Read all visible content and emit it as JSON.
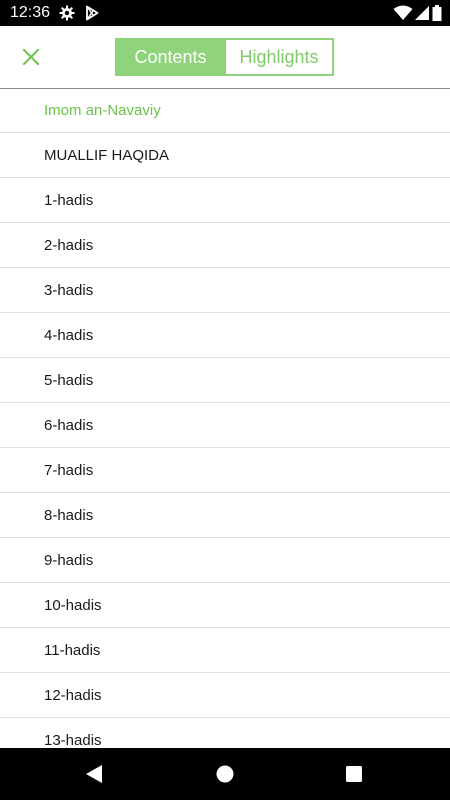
{
  "status_bar": {
    "time": "12:36",
    "icons_left": [
      "gear-icon",
      "play-store-icon"
    ],
    "icons_right": [
      "wifi-icon",
      "signal-icon",
      "battery-icon"
    ]
  },
  "toolbar": {
    "close_icon": "close-icon",
    "tabs": [
      {
        "label": "Contents",
        "selected": true
      },
      {
        "label": "Highlights",
        "selected": false
      }
    ]
  },
  "contents": {
    "items": [
      {
        "label": "Imom an-Navaviy",
        "active": true
      },
      {
        "label": "MUALLIF HAQIDA",
        "active": false
      },
      {
        "label": "1-hadis",
        "active": false
      },
      {
        "label": "2-hadis",
        "active": false
      },
      {
        "label": "3-hadis",
        "active": false
      },
      {
        "label": "4-hadis",
        "active": false
      },
      {
        "label": "5-hadis",
        "active": false
      },
      {
        "label": "6-hadis",
        "active": false
      },
      {
        "label": "7-hadis",
        "active": false
      },
      {
        "label": "8-hadis",
        "active": false
      },
      {
        "label": "9-hadis",
        "active": false
      },
      {
        "label": "10-hadis",
        "active": false
      },
      {
        "label": "11-hadis",
        "active": false
      },
      {
        "label": "12-hadis",
        "active": false
      },
      {
        "label": "13-hadis",
        "active": false
      }
    ]
  },
  "nav_bar": {
    "buttons": [
      "back-icon",
      "home-icon",
      "recents-icon"
    ]
  },
  "colors": {
    "accent": "#8fd47a",
    "active_text": "#6cc24a"
  }
}
